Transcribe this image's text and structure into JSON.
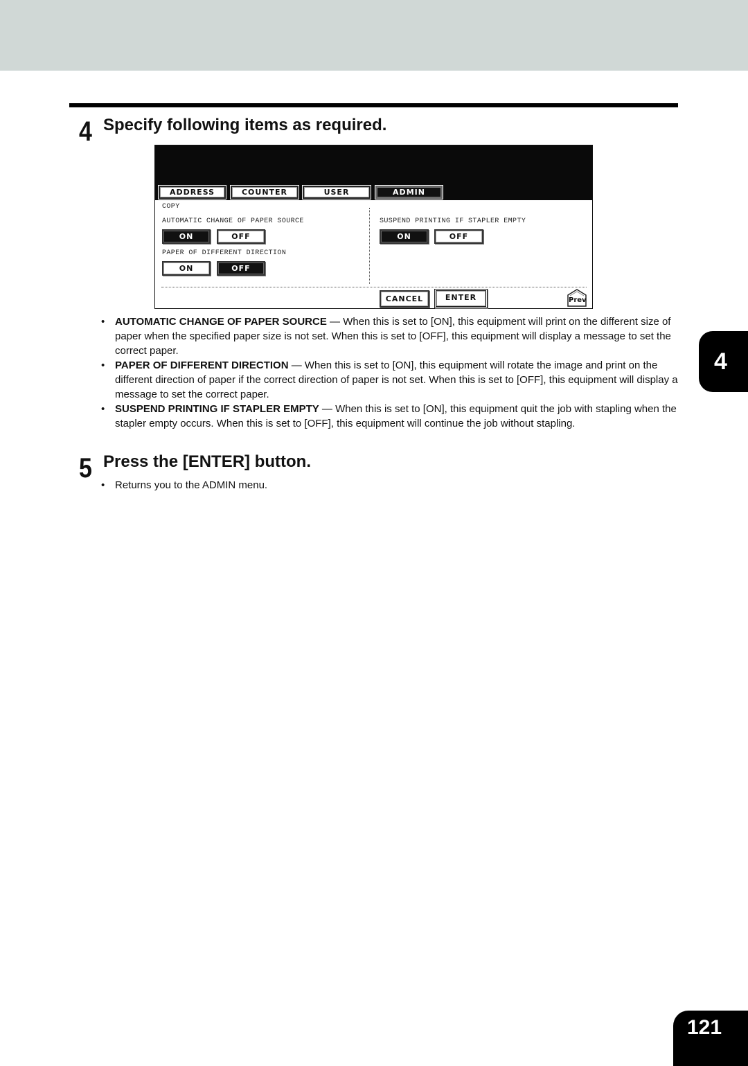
{
  "step4": {
    "number": "4",
    "title": "Specify following items as required."
  },
  "panel": {
    "tabs": [
      {
        "label": "ADDRESS",
        "active": false
      },
      {
        "label": "COUNTER",
        "active": false
      },
      {
        "label": "USER",
        "active": false
      },
      {
        "label": "ADMIN",
        "active": true
      }
    ],
    "section_label": "COPY",
    "settings": [
      {
        "label": "AUTOMATIC CHANGE OF PAPER SOURCE",
        "on_label": "ON",
        "off_label": "OFF",
        "selected": "ON"
      },
      {
        "label": "PAPER OF DIFFERENT DIRECTION",
        "on_label": "ON",
        "off_label": "OFF",
        "selected": "OFF"
      },
      {
        "label": "SUSPEND PRINTING IF STAPLER EMPTY",
        "on_label": "ON",
        "off_label": "OFF",
        "selected": "ON"
      }
    ],
    "cancel_label": "CANCEL",
    "enter_label": "ENTER",
    "prev_label": "Prev"
  },
  "bullets": [
    {
      "term": "AUTOMATIC CHANGE OF PAPER SOURCE",
      "text": " — When this is set to [ON], this equipment will print on the different size of paper when the specified paper size is not set.  When this is set to [OFF], this equipment will display a message to set the correct paper."
    },
    {
      "term": "PAPER OF DIFFERENT DIRECTION",
      "text": " — When this is set to [ON], this equipment will rotate the image and print on the different direction of paper if the correct direction of paper is not set.  When this is set to [OFF], this equipment will display a message to set the correct paper."
    },
    {
      "term": "SUSPEND PRINTING IF STAPLER EMPTY",
      "text": " — When this is set to [ON], this equipment quit the job with stapling when the stapler empty occurs.  When this is set to [OFF], this equipment will continue the job without stapling."
    }
  ],
  "bullet_glyph": "•",
  "step5": {
    "number": "5",
    "title": "Press the [ENTER] button.",
    "note": "Returns you to the ADMIN menu."
  },
  "chapter_tab": "4",
  "page_number": "121",
  "colors": {
    "header_band": "#d0d8d6",
    "panel_dark": "#0a0a0a"
  }
}
